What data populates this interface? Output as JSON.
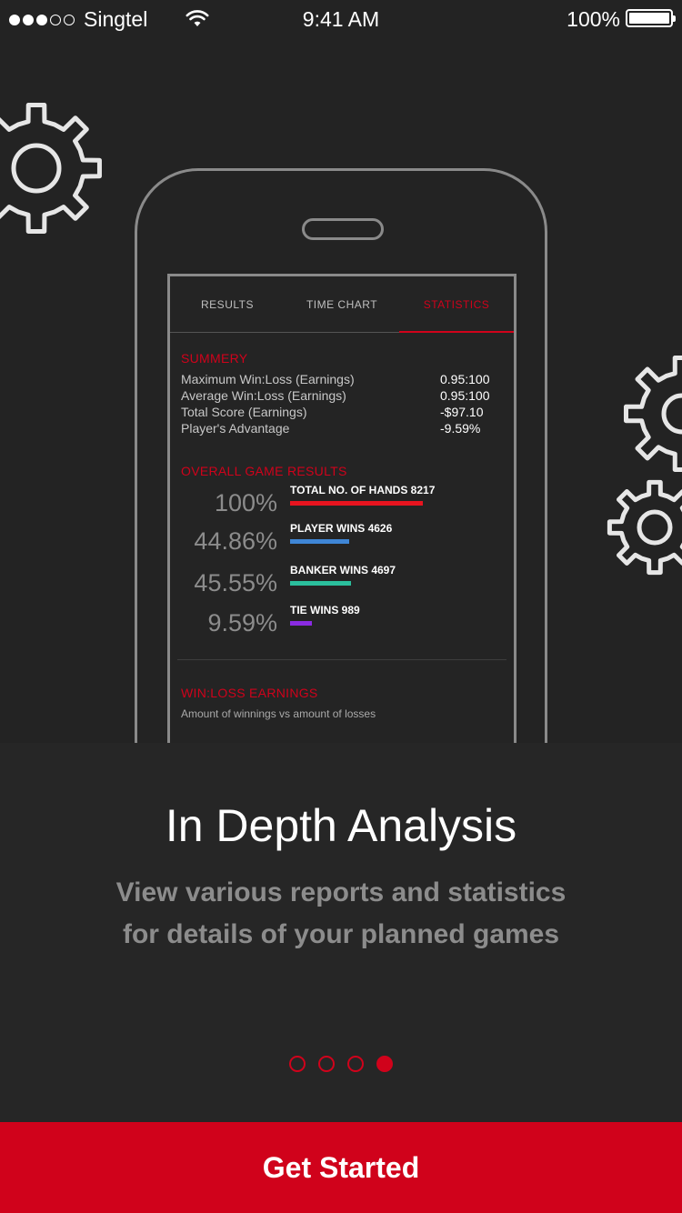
{
  "status_bar": {
    "carrier": "Singtel",
    "time": "9:41 AM",
    "battery_percent": "100%",
    "signal_bars_filled": 3,
    "signal_bars_total": 5
  },
  "mock_app": {
    "tabs": [
      {
        "label": "RESULTS",
        "active": false
      },
      {
        "label": "TIME CHART",
        "active": false
      },
      {
        "label": "STATISTICS",
        "active": true
      }
    ],
    "summary": {
      "title": "SUMMERY",
      "rows": [
        {
          "label": "Maximum Win:Loss (Earnings)",
          "value": "0.95:100"
        },
        {
          "label": "Average Win:Loss (Earnings)",
          "value": "0.95:100"
        },
        {
          "label": "Total Score (Earnings)",
          "value": "-$97.10"
        },
        {
          "label": "Player's Advantage",
          "value": "-9.59%"
        }
      ]
    },
    "overall": {
      "title": "OVERALL GAME RESULTS",
      "rows": [
        {
          "percent": "100%",
          "label": "TOTAL NO. OF HANDS  8217",
          "fraction": 1.0,
          "color": "#e8141f"
        },
        {
          "percent": "44.86%",
          "label": "PLAYER WINS 4626",
          "fraction": 0.4486,
          "color": "#3f86d6"
        },
        {
          "percent": "45.55%",
          "label": "BANKER  WINS 4697",
          "fraction": 0.4555,
          "color": "#2bbf9d"
        },
        {
          "percent": "9.59%",
          "label": "TIE WINS 989",
          "fraction": 0.0959,
          "color": "#8a2be2"
        }
      ]
    },
    "winloss": {
      "title": "WIN:LOSS EARNINGS",
      "subtitle": "Amount of winnings vs amount of losses"
    }
  },
  "onboarding": {
    "title": "In Depth Analysis",
    "description": "View various reports and statistics for details of your planned games",
    "page_count": 4,
    "active_page": 4
  },
  "cta": {
    "label": "Get Started"
  },
  "colors": {
    "accent": "#d0021b",
    "background": "#232323",
    "muted_text": "#8c8c8c"
  }
}
